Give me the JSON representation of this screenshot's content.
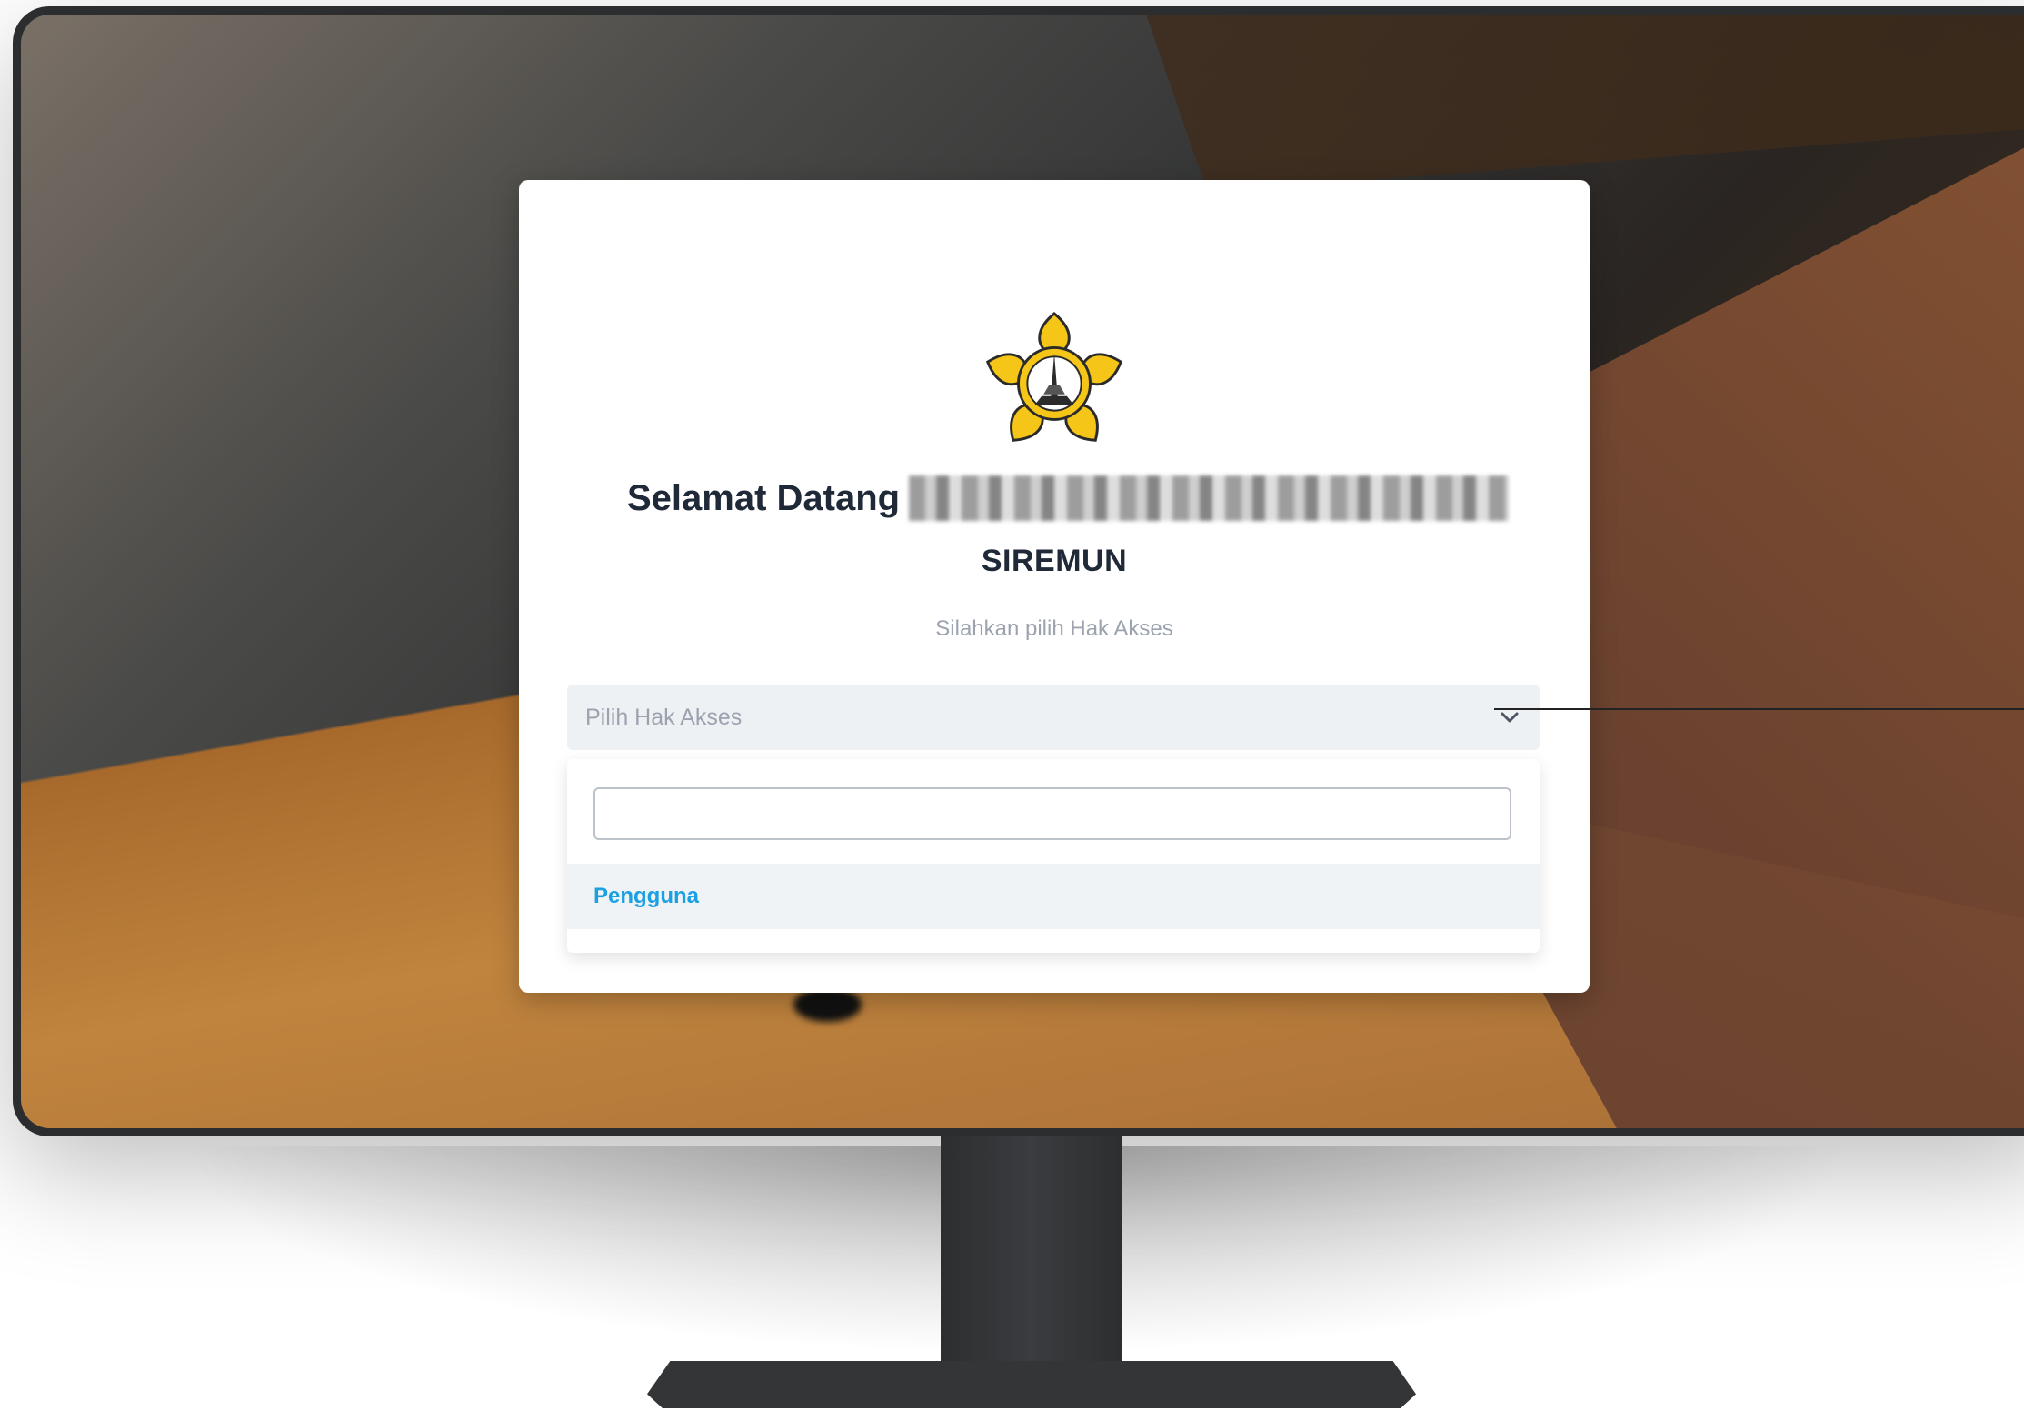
{
  "login": {
    "welcome": "Selamat Datang",
    "app_name": "SIREMUN",
    "subtitle": "Silahkan pilih Hak Akses",
    "select_placeholder": "Pilih Hak Akses",
    "search_value": "",
    "options": [
      {
        "label": "Pengguna"
      }
    ]
  },
  "icons": {
    "logo": "university-emblem-logo",
    "chevron": "chevron-down-icon"
  },
  "colors": {
    "option_text": "#1ba1e2",
    "logo_yellow": "#f5c518"
  }
}
